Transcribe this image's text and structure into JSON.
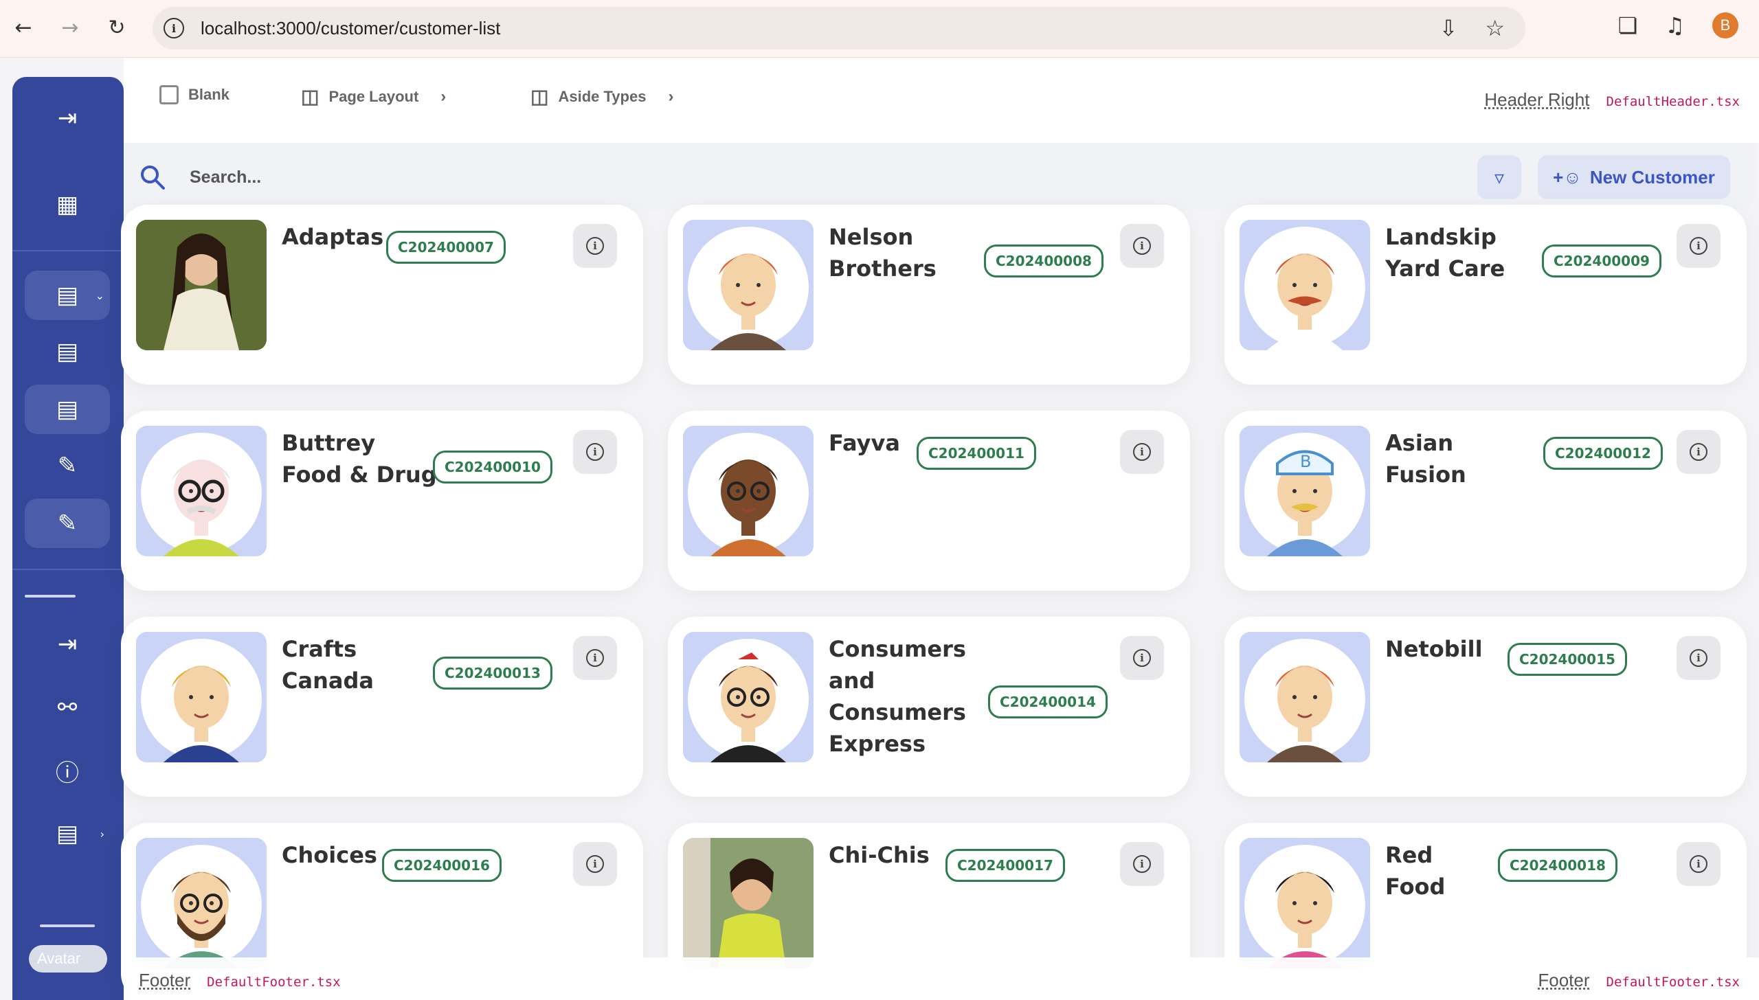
{
  "browser": {
    "url": "localhost:3000/customer/customer-list",
    "profile_initial": "B"
  },
  "header": {
    "blank_label": "Blank",
    "page_layout_label": "Page Layout",
    "aside_types_label": "Aside Types",
    "header_right_label": "Header Right",
    "header_file": "DefaultHeader.tsx"
  },
  "toolbar": {
    "search_placeholder": "Search...",
    "new_customer_label": "New Customer"
  },
  "sidebar": {
    "avatar_alt": "Avatar"
  },
  "customers": [
    {
      "name": "Adaptas",
      "code": "C202400007",
      "avatar": "photo-woman"
    },
    {
      "name": "Nelson Brothers",
      "code": "C202400008",
      "avatar": "redhead-man"
    },
    {
      "name": "Landskip Yard Care",
      "code": "C202400009",
      "avatar": "mustache-man"
    },
    {
      "name": "Buttrey Food & Drug",
      "code": "C202400010",
      "avatar": "old-man-glasses"
    },
    {
      "name": "Fayva",
      "code": "C202400011",
      "avatar": "afro-man-glasses"
    },
    {
      "name": "Asian Fusion",
      "code": "C202400012",
      "avatar": "cap-man"
    },
    {
      "name": "Crafts Canada",
      "code": "C202400013",
      "avatar": "blond-man"
    },
    {
      "name": "Consumers and Consumers Express",
      "code": "C202400014",
      "avatar": "woman-glasses"
    },
    {
      "name": "Netobill",
      "code": "C202400015",
      "avatar": "redhead-man"
    },
    {
      "name": "Choices",
      "code": "C202400016",
      "avatar": "bearded-man"
    },
    {
      "name": "Chi-Chis",
      "code": "C202400017",
      "avatar": "photo-woman-yellow"
    },
    {
      "name": "Red Food",
      "code": "C202400018",
      "avatar": "black-hair-woman"
    }
  ],
  "footer": {
    "left_label": "Footer",
    "left_file": "DefaultFooter.tsx",
    "right_label": "Footer",
    "right_file": "DefaultFooter.tsx"
  },
  "colors": {
    "sidebar_bg": "#34479a",
    "badge_green": "#2e7d4f",
    "accent_blue": "#3b56c4",
    "code_red": "#c2185b"
  }
}
